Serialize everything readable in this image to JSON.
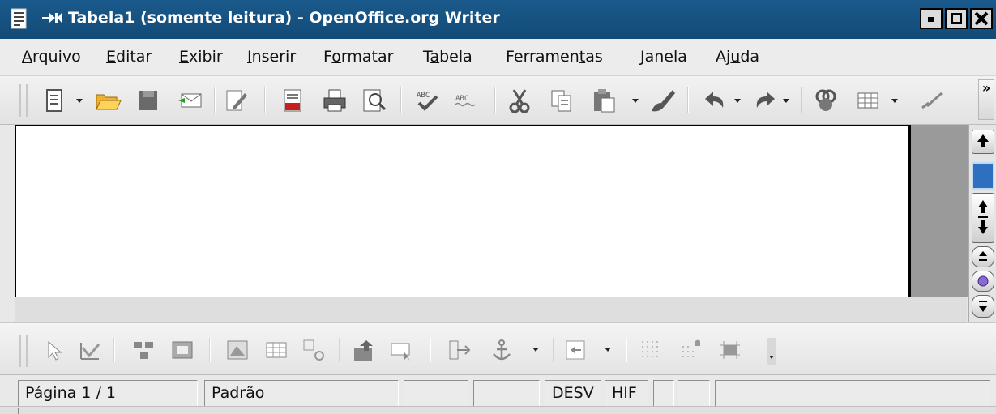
{
  "window": {
    "title": "Tabela1 (somente leitura) - OpenOffice.org Writer"
  },
  "menu": [
    {
      "pre": "",
      "u": "A",
      "post": "rquivo"
    },
    {
      "pre": "",
      "u": "E",
      "post": "ditar"
    },
    {
      "pre": "",
      "u": "E",
      "post": "xibir"
    },
    {
      "pre": "",
      "u": "I",
      "post": "nserir"
    },
    {
      "pre": "F",
      "u": "o",
      "post": "rmatar"
    },
    {
      "pre": "T",
      "u": "a",
      "post": "bela"
    },
    {
      "pre": "Ferramen",
      "u": "t",
      "post": "as"
    },
    {
      "pre": "",
      "u": "J",
      "post": "anela"
    },
    {
      "pre": "Aj",
      "u": "u",
      "post": "da"
    }
  ],
  "toolbar": {
    "more_label": "»"
  },
  "statusbar": {
    "page": "Página 1 / 1",
    "style": "Padrão",
    "insert_mode": "",
    "selection_mode": "",
    "desv": "DESV",
    "hif": "HIF"
  }
}
